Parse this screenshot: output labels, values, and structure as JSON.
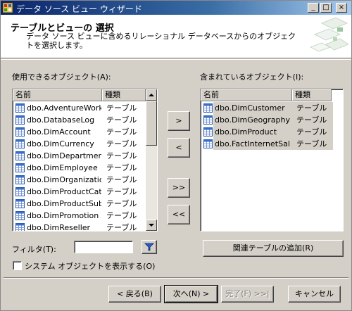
{
  "window": {
    "title": "データ ソース ビュー ウィザード",
    "minimize_label": "_",
    "maximize_label": "□",
    "close_label": "×"
  },
  "header": {
    "title": "テーブルとビューの 選択",
    "description": "データ ソース ビューに含めるリレーショナル データベースからのオブジェクトを選択します。"
  },
  "available": {
    "label": "使用できるオブジェクト(A):",
    "col_name": "名前",
    "col_type": "種類",
    "items": [
      {
        "name": "dbo.AdventureWork...",
        "type": "テーブル"
      },
      {
        "name": "dbo.DatabaseLog",
        "type": "テーブル"
      },
      {
        "name": "dbo.DimAccount",
        "type": "テーブル"
      },
      {
        "name": "dbo.DimCurrency",
        "type": "テーブル"
      },
      {
        "name": "dbo.DimDepartment...",
        "type": "テーブル"
      },
      {
        "name": "dbo.DimEmployee",
        "type": "テーブル"
      },
      {
        "name": "dbo.DimOrganization",
        "type": "テーブル"
      },
      {
        "name": "dbo.DimProductCat...",
        "type": "テーブル"
      },
      {
        "name": "dbo.DimProductSub...",
        "type": "テーブル"
      },
      {
        "name": "dbo.DimPromotion",
        "type": "テーブル"
      },
      {
        "name": "dbo.DimReseller",
        "type": "テーブル"
      }
    ]
  },
  "included": {
    "label": "含まれているオブジェクト(I):",
    "col_name": "名前",
    "col_type": "種類",
    "items": [
      {
        "name": "dbo.DimCustomer",
        "type": "テーブル"
      },
      {
        "name": "dbo.DimGeography",
        "type": "テーブル"
      },
      {
        "name": "dbo.DimProduct",
        "type": "テーブル"
      },
      {
        "name": "dbo.FactInternetSal...",
        "type": "テーブル"
      }
    ]
  },
  "move_buttons": {
    "add": ">",
    "remove": "<",
    "add_all": ">>",
    "remove_all": "<<"
  },
  "filter": {
    "label": "フィルタ(T):",
    "value": ""
  },
  "show_system": {
    "label": "システム オブジェクトを表示する(O)",
    "checked": false
  },
  "related_button": "関連テーブルの追加(R)",
  "footer": {
    "back": "< 戻る(B)",
    "next": "次へ(N) >",
    "finish": "完了(F) >>|",
    "cancel": "キャンセル"
  }
}
